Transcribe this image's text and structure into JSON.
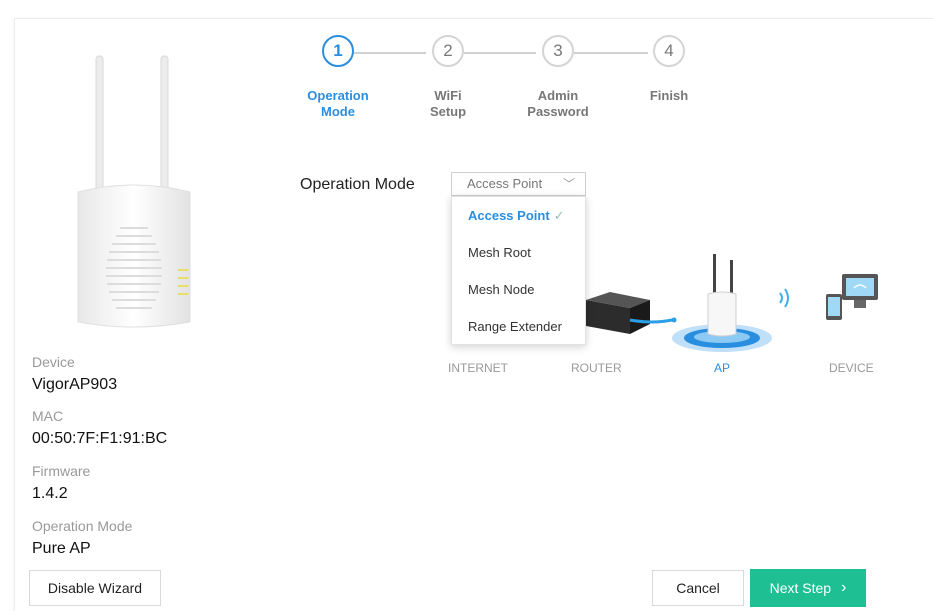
{
  "device": {
    "device_label": "Device",
    "device_value": "VigorAP903",
    "mac_label": "MAC",
    "mac_value": "00:50:7F:F1:91:BC",
    "firmware_label": "Firmware",
    "firmware_value": "1.4.2",
    "opmode_label": "Operation Mode",
    "opmode_value": "Pure AP"
  },
  "steps": [
    {
      "num": "1",
      "label": "Operation Mode",
      "active": true
    },
    {
      "num": "2",
      "label": "WiFi Setup",
      "active": false
    },
    {
      "num": "3",
      "label": "Admin Password",
      "active": false
    },
    {
      "num": "4",
      "label": "Finish",
      "active": false
    }
  ],
  "operation_mode": {
    "label": "Operation Mode",
    "selected": "Access Point",
    "options": [
      "Access Point",
      "Mesh Root",
      "Mesh Node",
      "Range Extender"
    ]
  },
  "topology": {
    "internet": "INTERNET",
    "router": "ROUTER",
    "ap": "AP",
    "device": "DEVICE"
  },
  "buttons": {
    "disable_wizard": "Disable Wizard",
    "cancel": "Cancel",
    "next_step": "Next Step"
  },
  "colors": {
    "accent": "#2a8ee0",
    "primary_button": "#1fbf94"
  },
  "icons": [
    "ap-device-image",
    "chevron-down-icon",
    "check-icon",
    "router-icon",
    "access-point-icon",
    "wifi-signal-icon",
    "devices-icon",
    "chevron-right-icon"
  ]
}
